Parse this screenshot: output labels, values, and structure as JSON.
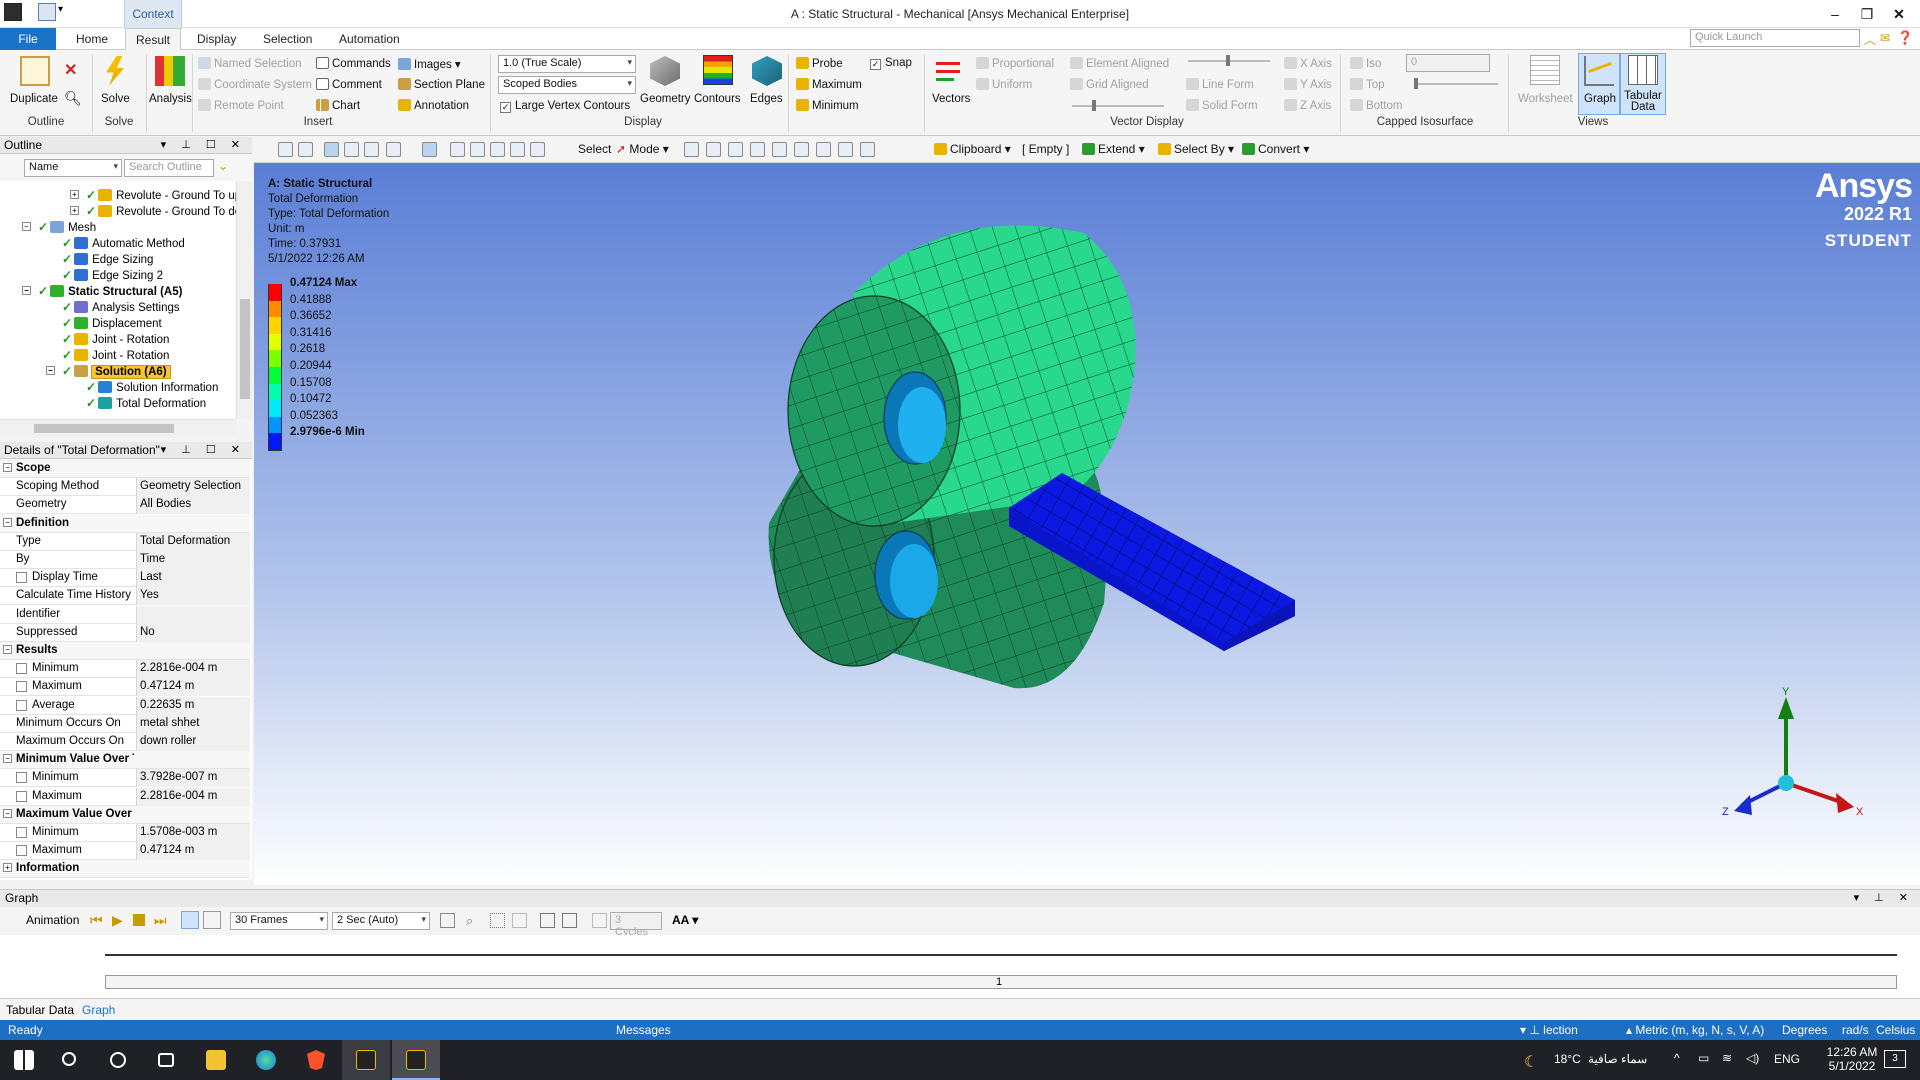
{
  "window": {
    "title": "A : Static Structural - Mechanical [Ansys Mechanical Enterprise]",
    "context_tab": "Context",
    "quick_launch_placeholder": "Quick Launch"
  },
  "tabs": [
    "File",
    "Home",
    "Result",
    "Display",
    "Selection",
    "Automation"
  ],
  "ribbon": {
    "outline": {
      "duplicate": "Duplicate",
      "label": "Outline"
    },
    "solve": {
      "solve": "Solve",
      "label": "Solve"
    },
    "analysis": {
      "analysis": "Analysis"
    },
    "insert": {
      "named_selection": "Named Selection",
      "coordinate_system": "Coordinate System",
      "remote_point": "Remote Point",
      "commands": "Commands",
      "comment": "Comment",
      "chart": "Chart",
      "images": "Images",
      "section_plane": "Section Plane",
      "annotation": "Annotation",
      "label": "Insert"
    },
    "display": {
      "scale": "1.0 (True Scale)",
      "bodies": "Scoped Bodies",
      "large_vertex": "Large Vertex Contours",
      "geometry": "Geometry",
      "contours": "Contours",
      "edges": "Edges",
      "label": "Display"
    },
    "probe": {
      "probe": "Probe",
      "maximum": "Maximum",
      "minimum": "Minimum",
      "snap": "Snap"
    },
    "vector": {
      "vectors": "Vectors",
      "proportional": "Proportional",
      "uniform": "Uniform",
      "element_aligned": "Element Aligned",
      "grid_aligned": "Grid Aligned",
      "line_form": "Line Form",
      "solid_form": "Solid Form",
      "x_axis": "X Axis",
      "y_axis": "Y Axis",
      "z_axis": "Z Axis",
      "label": "Vector Display"
    },
    "isosurface": {
      "iso": "Iso",
      "top": "Top",
      "bottom": "Bottom",
      "value": "0",
      "label": "Capped Isosurface"
    },
    "views": {
      "worksheet": "Worksheet",
      "graph": "Graph",
      "tabular": "Tabular",
      "tabular2": "Data",
      "label": "Views"
    }
  },
  "outline": {
    "title": "Outline",
    "name_filter": "Name",
    "search_placeholder": "Search Outline",
    "tree": [
      {
        "label": "Revolute - Ground To up r",
        "indent": 3
      },
      {
        "label": "Revolute - Ground To dov",
        "indent": 3
      },
      {
        "label": "Mesh",
        "indent": 1
      },
      {
        "label": "Automatic Method",
        "indent": 2
      },
      {
        "label": "Edge Sizing",
        "indent": 2
      },
      {
        "label": "Edge Sizing 2",
        "indent": 2
      },
      {
        "label": "Static Structural (A5)",
        "indent": 1
      },
      {
        "label": "Analysis Settings",
        "indent": 2
      },
      {
        "label": "Displacement",
        "indent": 2
      },
      {
        "label": "Joint - Rotation",
        "indent": 2
      },
      {
        "label": "Joint - Rotation",
        "indent": 2
      },
      {
        "label": "Solution (A6)",
        "indent": 2
      },
      {
        "label": "Solution Information",
        "indent": 3
      },
      {
        "label": "Total Deformation",
        "indent": 3
      }
    ]
  },
  "details": {
    "title": "Details of \"Total Deformation\"",
    "rows": [
      {
        "type": "cat",
        "k": "Scope"
      },
      {
        "type": "row",
        "k": "Scoping Method",
        "v": "Geometry Selection"
      },
      {
        "type": "row",
        "k": "Geometry",
        "v": "All Bodies"
      },
      {
        "type": "cat",
        "k": "Definition"
      },
      {
        "type": "row",
        "k": "Type",
        "v": "Total Deformation"
      },
      {
        "type": "row",
        "k": "By",
        "v": "Time"
      },
      {
        "type": "chk",
        "k": "Display Time",
        "v": "Last"
      },
      {
        "type": "row",
        "k": "Calculate Time History",
        "v": "Yes"
      },
      {
        "type": "row",
        "k": "Identifier",
        "v": ""
      },
      {
        "type": "row",
        "k": "Suppressed",
        "v": "No"
      },
      {
        "type": "cat",
        "k": "Results"
      },
      {
        "type": "chk",
        "k": "Minimum",
        "v": "2.2816e-004 m"
      },
      {
        "type": "chk",
        "k": "Maximum",
        "v": "0.47124 m"
      },
      {
        "type": "chk",
        "k": "Average",
        "v": "0.22635 m"
      },
      {
        "type": "row",
        "k": "Minimum Occurs On",
        "v": "metal shhet"
      },
      {
        "type": "row",
        "k": "Maximum Occurs On",
        "v": "down roller"
      },
      {
        "type": "cat",
        "k": "Minimum Value Over Time"
      },
      {
        "type": "chk",
        "k": "Minimum",
        "v": "3.7928e-007 m"
      },
      {
        "type": "chk",
        "k": "Maximum",
        "v": "2.2816e-004 m"
      },
      {
        "type": "cat",
        "k": "Maximum Value Over Time"
      },
      {
        "type": "chk",
        "k": "Minimum",
        "v": "1.5708e-003 m"
      },
      {
        "type": "chk",
        "k": "Maximum",
        "v": "0.47124 m"
      },
      {
        "type": "catc",
        "k": "Information"
      }
    ]
  },
  "viewport_toolbar": {
    "select": "Select",
    "mode": "Mode",
    "clipboard": "Clipboard",
    "empty": "[ Empty ]",
    "extend": "Extend",
    "select_by": "Select By",
    "convert": "Convert"
  },
  "result_info": {
    "name": "A: Static Structural",
    "result": "Total Deformation",
    "type": "Type: Total Deformation",
    "unit": "Unit: m",
    "time": "Time: 0.37931",
    "date": "5/1/2022 12:26 AM"
  },
  "legend": {
    "max": "0.47124 Max",
    "levels": [
      "0.41888",
      "0.36652",
      "0.31416",
      "0.2618",
      "0.20944",
      "0.15708",
      "0.10472",
      "0.052363"
    ],
    "min": "2.9796e-6 Min",
    "colors": [
      "#ff0000",
      "#ff8c00",
      "#ffd500",
      "#e3ff00",
      "#7cff00",
      "#00ff3a",
      "#00ffb0",
      "#00e8ff",
      "#0096ff",
      "#0018ff"
    ]
  },
  "brand": {
    "name": "Ansys",
    "version": "2022 R1",
    "edition": "STUDENT"
  },
  "triad": {
    "x": "X",
    "y": "Y",
    "z": "Z"
  },
  "graph": {
    "title": "Graph",
    "animation": "Animation",
    "frames": "30 Frames",
    "duration": "2 Sec (Auto)",
    "cycles": "3 Cycles",
    "aa": "AA",
    "timeline_label": "1"
  },
  "bottom_tabs": [
    "Tabular Data",
    "Graph"
  ],
  "status": {
    "ready": "Ready",
    "messages": "Messages",
    "selection": "lection",
    "units": "Metric (m, kg, N, s, V, A)",
    "degrees": "Degrees",
    "rads": "rad/s",
    "celsius": "Celsius"
  },
  "taskbar": {
    "weather": "18°C",
    "weather_text": "سماء صافية",
    "lang": "ENG",
    "time": "12:26 AM",
    "date": "5/1/2022",
    "notifications": "3"
  }
}
